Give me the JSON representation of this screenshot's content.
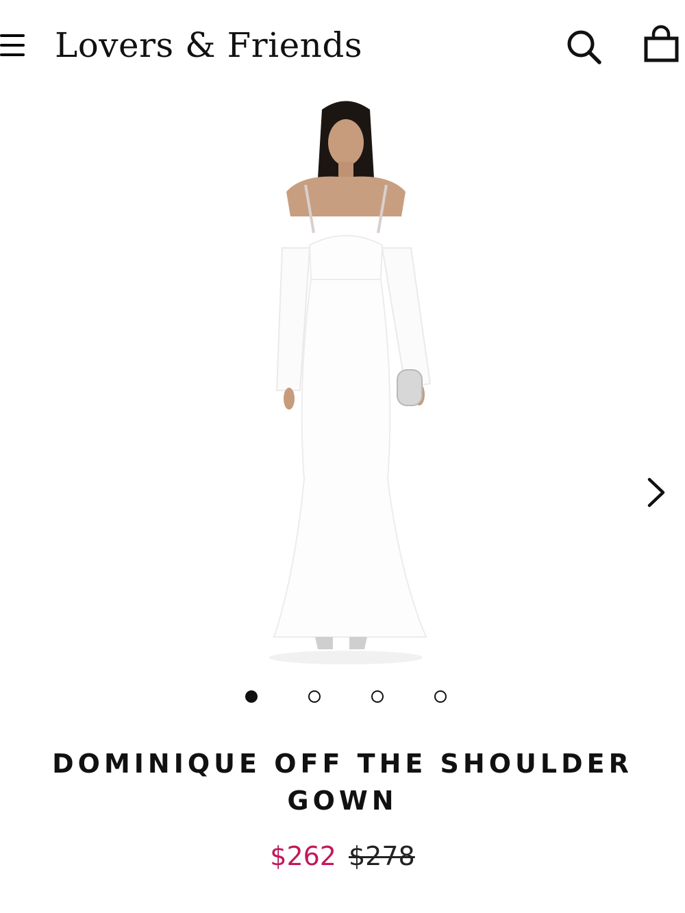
{
  "header": {
    "brand": "Lovers & Friends",
    "menu_icon": "hamburger-menu-icon",
    "search_icon": "search-icon",
    "bag_icon": "shopping-bag-icon"
  },
  "gallery": {
    "next_icon": "chevron-right-icon",
    "total_images": 4,
    "active_index": 0
  },
  "product": {
    "title": "DOMINIQUE OFF THE SHOULDER GOWN",
    "sale_price": "$262",
    "original_price": "$278"
  },
  "colors": {
    "sale_price": "#c2185b",
    "text": "#111111",
    "background": "#ffffff"
  }
}
